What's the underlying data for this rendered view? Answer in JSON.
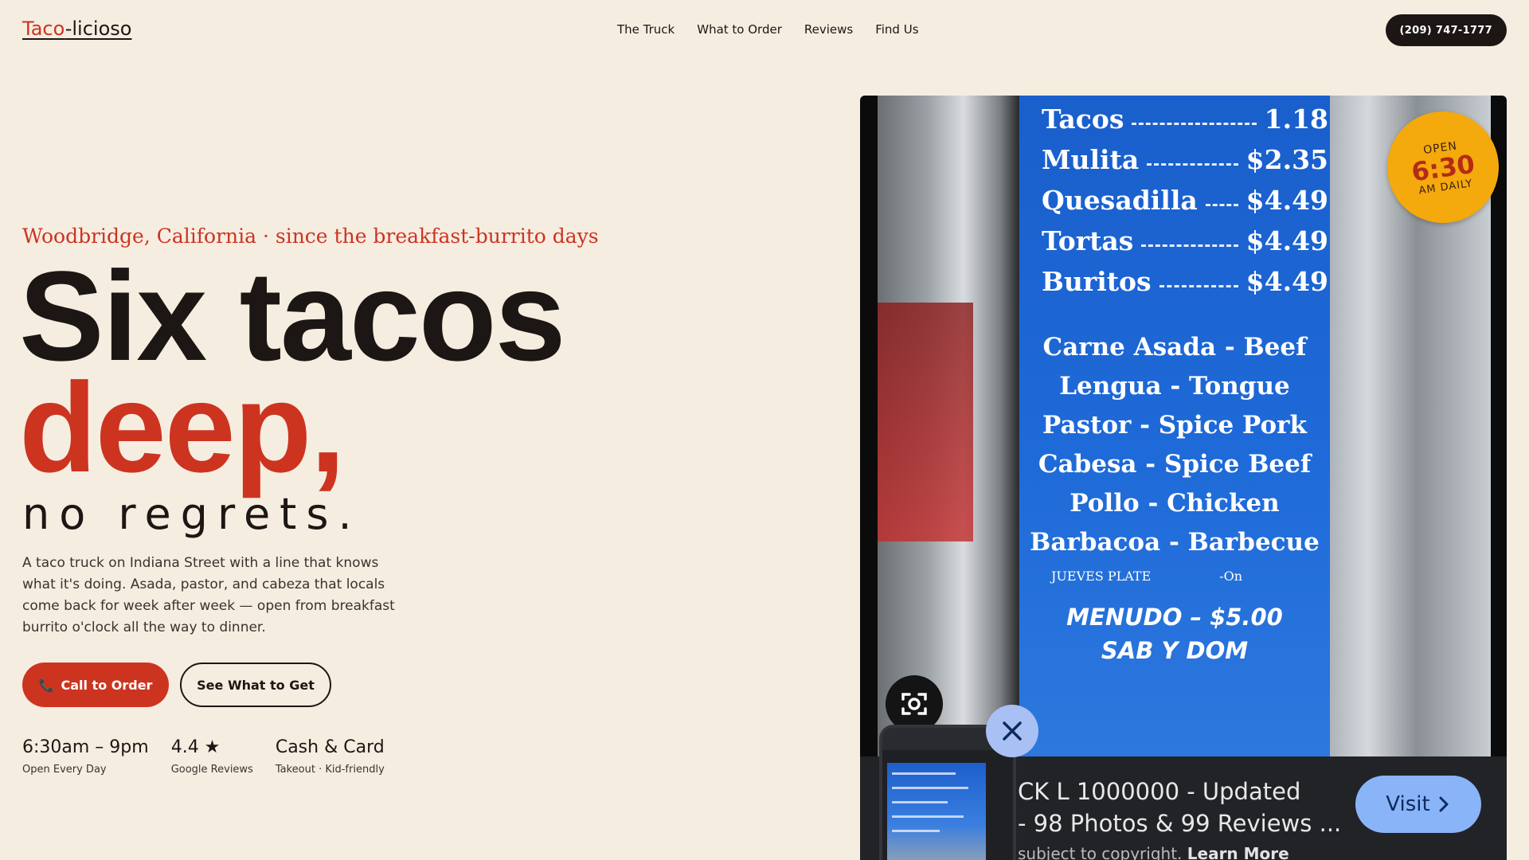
{
  "nav": {
    "logo_part1": "Taco",
    "logo_part2": "-licioso",
    "links": [
      "The Truck",
      "What to Order",
      "Reviews",
      "Find Us"
    ],
    "phone": "(209) 747-1777"
  },
  "hero": {
    "eyebrow": "Woodbridge, California · since the breakfast-burrito days",
    "headline_1": "Six tacos",
    "headline_2": "deep,",
    "headline_3": "no regrets.",
    "blurb": "A taco truck on Indiana Street with a line that knows what it's doing. Asada, pastor, and cabeza that locals come back for week after week — open from breakfast burrito o'clock all the way to dinner.",
    "cta_primary": "Call to Order",
    "cta_primary_icon": "phone-icon",
    "cta_secondary": "See What to Get",
    "stats": [
      {
        "value": "6:30am – 9pm",
        "label": "Open Every Day"
      },
      {
        "value": "4.4 ★",
        "label": "Google Reviews"
      },
      {
        "value": "Cash & Card",
        "label": "Takeout · Kid-friendly"
      }
    ]
  },
  "photo": {
    "menu_prices": [
      {
        "item": "Tacos",
        "price": "1.18"
      },
      {
        "item": "Mulita",
        "price": "$2.35"
      },
      {
        "item": "Quesadilla",
        "price": "$4.49"
      },
      {
        "item": "Tortas",
        "price": "$4.49"
      },
      {
        "item": "Buritos",
        "price": "$4.49"
      }
    ],
    "menu_meats": [
      "Carne Asada - Beef",
      "Lengua - Tongue",
      "Pastor - Spice Pork",
      "Cabesa - Spice Beef",
      "Pollo - Chicken",
      "Barbacoa - Barbecue"
    ],
    "menu_small_left": "JUEVES PLATE",
    "menu_small_right": "-On",
    "menudo_1": "MENUDO – $5.00",
    "menudo_2": "SAB Y DOM",
    "badge_top": "OPEN",
    "badge_time": "6:30",
    "badge_bottom": "AM DAILY"
  },
  "lens_overlay": {
    "result_title_1": "CK L 1000000 - Updated",
    "result_title_2": "- 98 Photos & 99 Reviews ...",
    "result_sub": "subject to copyright.",
    "result_sub_link": "Learn More",
    "visit_label": "Visit",
    "icons": [
      "lens-camera-icon",
      "close-icon",
      "chevron-right-icon"
    ]
  }
}
